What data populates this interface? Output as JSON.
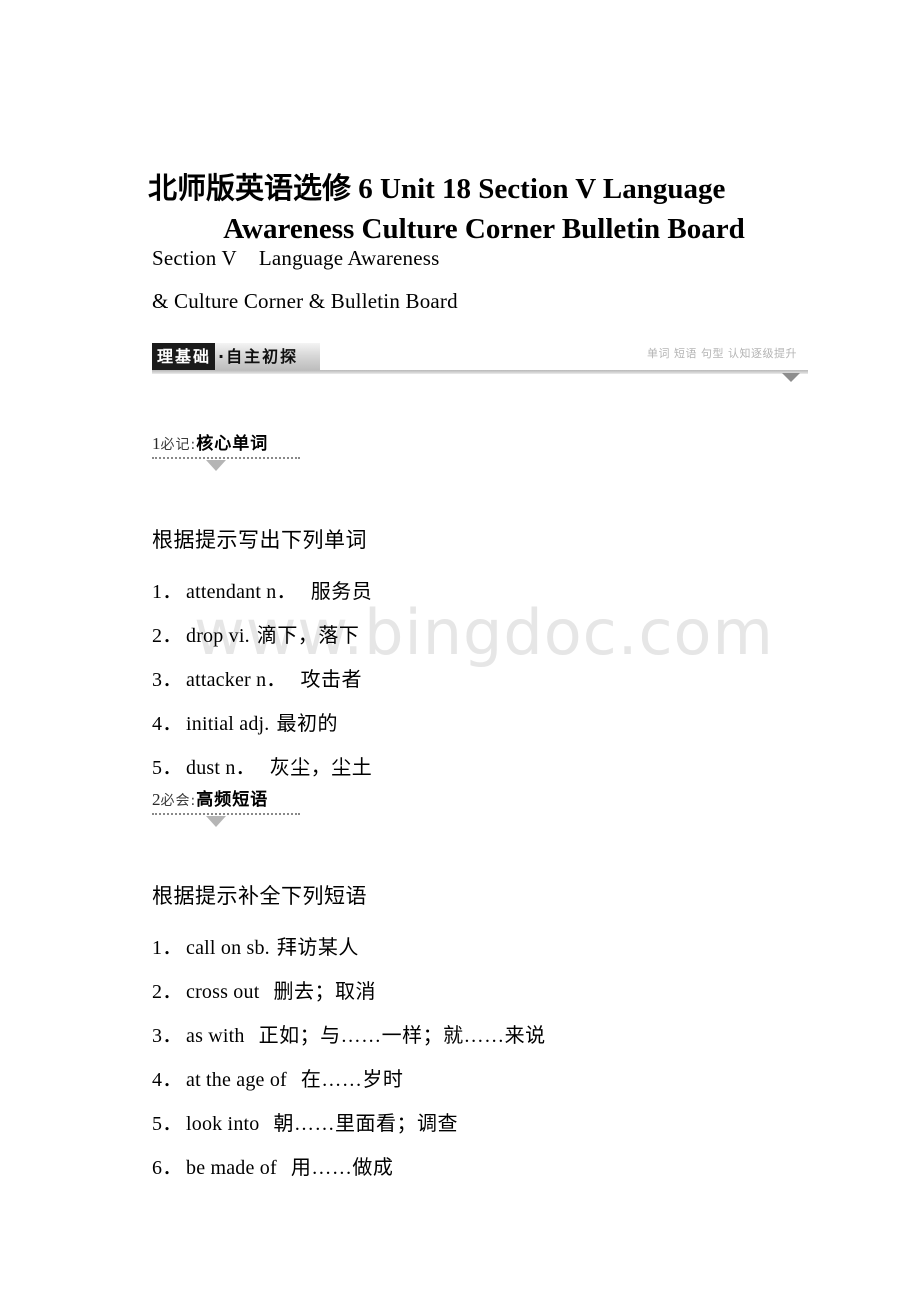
{
  "document": {
    "title_line1": "北师版英语选修 6 Unit 18 Section V Language",
    "title_line2": "Awareness Culture Corner Bulletin Board",
    "subtitle_line1_a": "Section V",
    "subtitle_line1_b": "Language Awareness",
    "subtitle_line2": "& Culture Corner & Bulletin Board",
    "watermark": "www.bingdoc.com"
  },
  "banner": {
    "dark_label": "理基础",
    "light_label": "·自主初探",
    "tagline": "单词 短语 句型 认知逐级提升",
    "colors": {
      "dark_bg": "#1b1b1b",
      "light_bg": "#d8d8d8",
      "tagline_color": "#b4b4b4",
      "rule_color": "#b9b9b9",
      "caret_color": "#8d8d8d"
    }
  },
  "sections": [
    {
      "index": "1",
      "kicker": "必记",
      "colon": ":",
      "heading": "核心单词",
      "prompt": "根据提示写出下列单词",
      "items": [
        {
          "num": "1．",
          "english": "attendant n．",
          "chinese": "服务员",
          "gap": "md"
        },
        {
          "num": "2．",
          "english": "drop vi.",
          "chinese": "滴下，落下",
          "gap": "sm"
        },
        {
          "num": "3．",
          "english": "attacker n．",
          "chinese": "攻击者",
          "gap": "md"
        },
        {
          "num": "4．",
          "english": "initial adj.",
          "chinese": "最初的",
          "gap": "sm"
        },
        {
          "num": "5．",
          "english": "dust n．",
          "chinese": "灰尘，尘土",
          "gap": "md"
        }
      ]
    },
    {
      "index": "2",
      "kicker": "必会",
      "colon": ":",
      "heading": "高频短语",
      "prompt": "根据提示补全下列短语",
      "items": [
        {
          "num": "1．",
          "english": "call on sb.",
          "chinese": "拜访某人",
          "gap": "sm"
        },
        {
          "num": "2．",
          "english": "cross out",
          "chinese": "删去；取消",
          "gap": "md"
        },
        {
          "num": "3．",
          "english": "as with",
          "chinese": "正如；与……一样；就……来说",
          "gap": "md"
        },
        {
          "num": "4．",
          "english": "at the age of",
          "chinese": "在……岁时",
          "gap": "md"
        },
        {
          "num": "5．",
          "english": "look into",
          "chinese": "朝……里面看；调查",
          "gap": "md"
        },
        {
          "num": "6．",
          "english": "be made of",
          "chinese": "用……做成",
          "gap": "md"
        }
      ]
    }
  ]
}
